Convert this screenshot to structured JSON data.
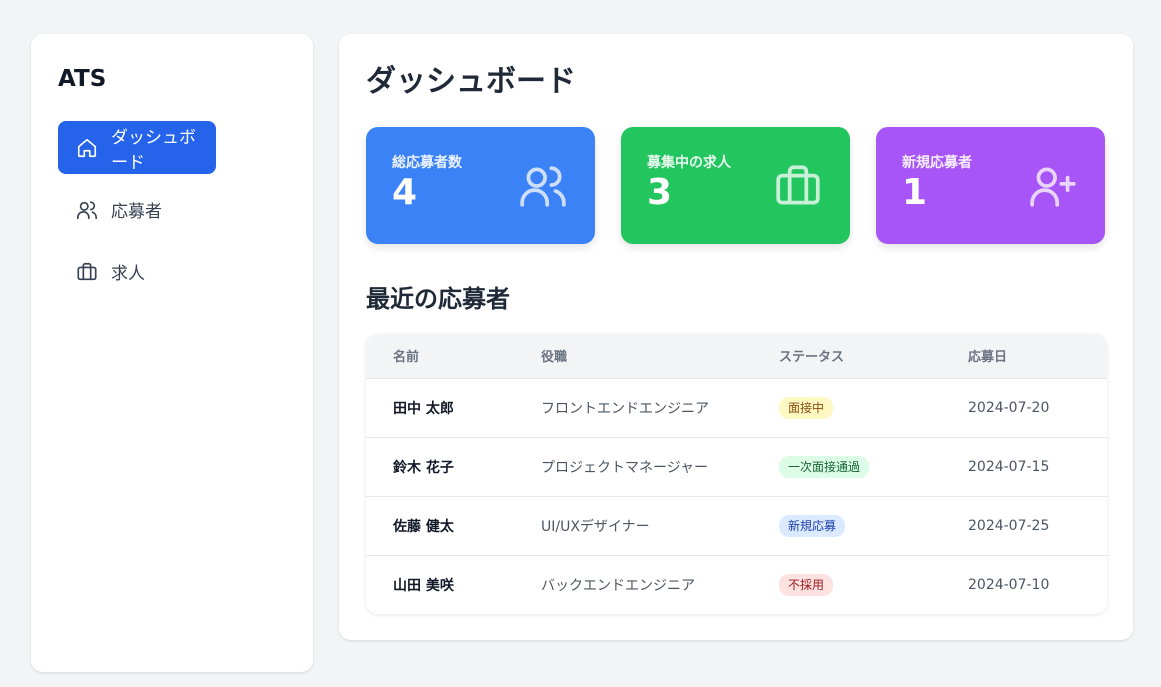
{
  "sidebar": {
    "brand": "ATS",
    "items": [
      {
        "label": "ダッシュボード",
        "icon": "home-icon",
        "active": true
      },
      {
        "label": "応募者",
        "icon": "users-icon",
        "active": false
      },
      {
        "label": "求人",
        "icon": "briefcase-icon",
        "active": false
      }
    ]
  },
  "main": {
    "title": "ダッシュボード",
    "cards": [
      {
        "label": "総応募者数",
        "value": "4",
        "color": "#3b82f6",
        "icon": "users-icon"
      },
      {
        "label": "募集中の求人",
        "value": "3",
        "color": "#22c55e",
        "icon": "briefcase-icon"
      },
      {
        "label": "新規応募者",
        "value": "1",
        "color": "#a855f7",
        "icon": "user-plus-icon"
      }
    ],
    "recent": {
      "title": "最近の応募者",
      "headers": [
        "名前",
        "役職",
        "ステータス",
        "応募日"
      ],
      "rows": [
        {
          "name": "田中 太郎",
          "role": "フロントエンドエンジニア",
          "status": "面接中",
          "status_bg": "#fef9c3",
          "status_fg": "#854d0e",
          "date": "2024-07-20"
        },
        {
          "name": "鈴木 花子",
          "role": "プロジェクトマネージャー",
          "status": "一次面接通過",
          "status_bg": "#dcfce7",
          "status_fg": "#166534",
          "date": "2024-07-15"
        },
        {
          "name": "佐藤 健太",
          "role": "UI/UXデザイナー",
          "status": "新規応募",
          "status_bg": "#dbeafe",
          "status_fg": "#1e40af",
          "date": "2024-07-25"
        },
        {
          "name": "山田 美咲",
          "role": "バックエンドエンジニア",
          "status": "不採用",
          "status_bg": "#fee2e2",
          "status_fg": "#991b1b",
          "date": "2024-07-10"
        }
      ]
    }
  }
}
